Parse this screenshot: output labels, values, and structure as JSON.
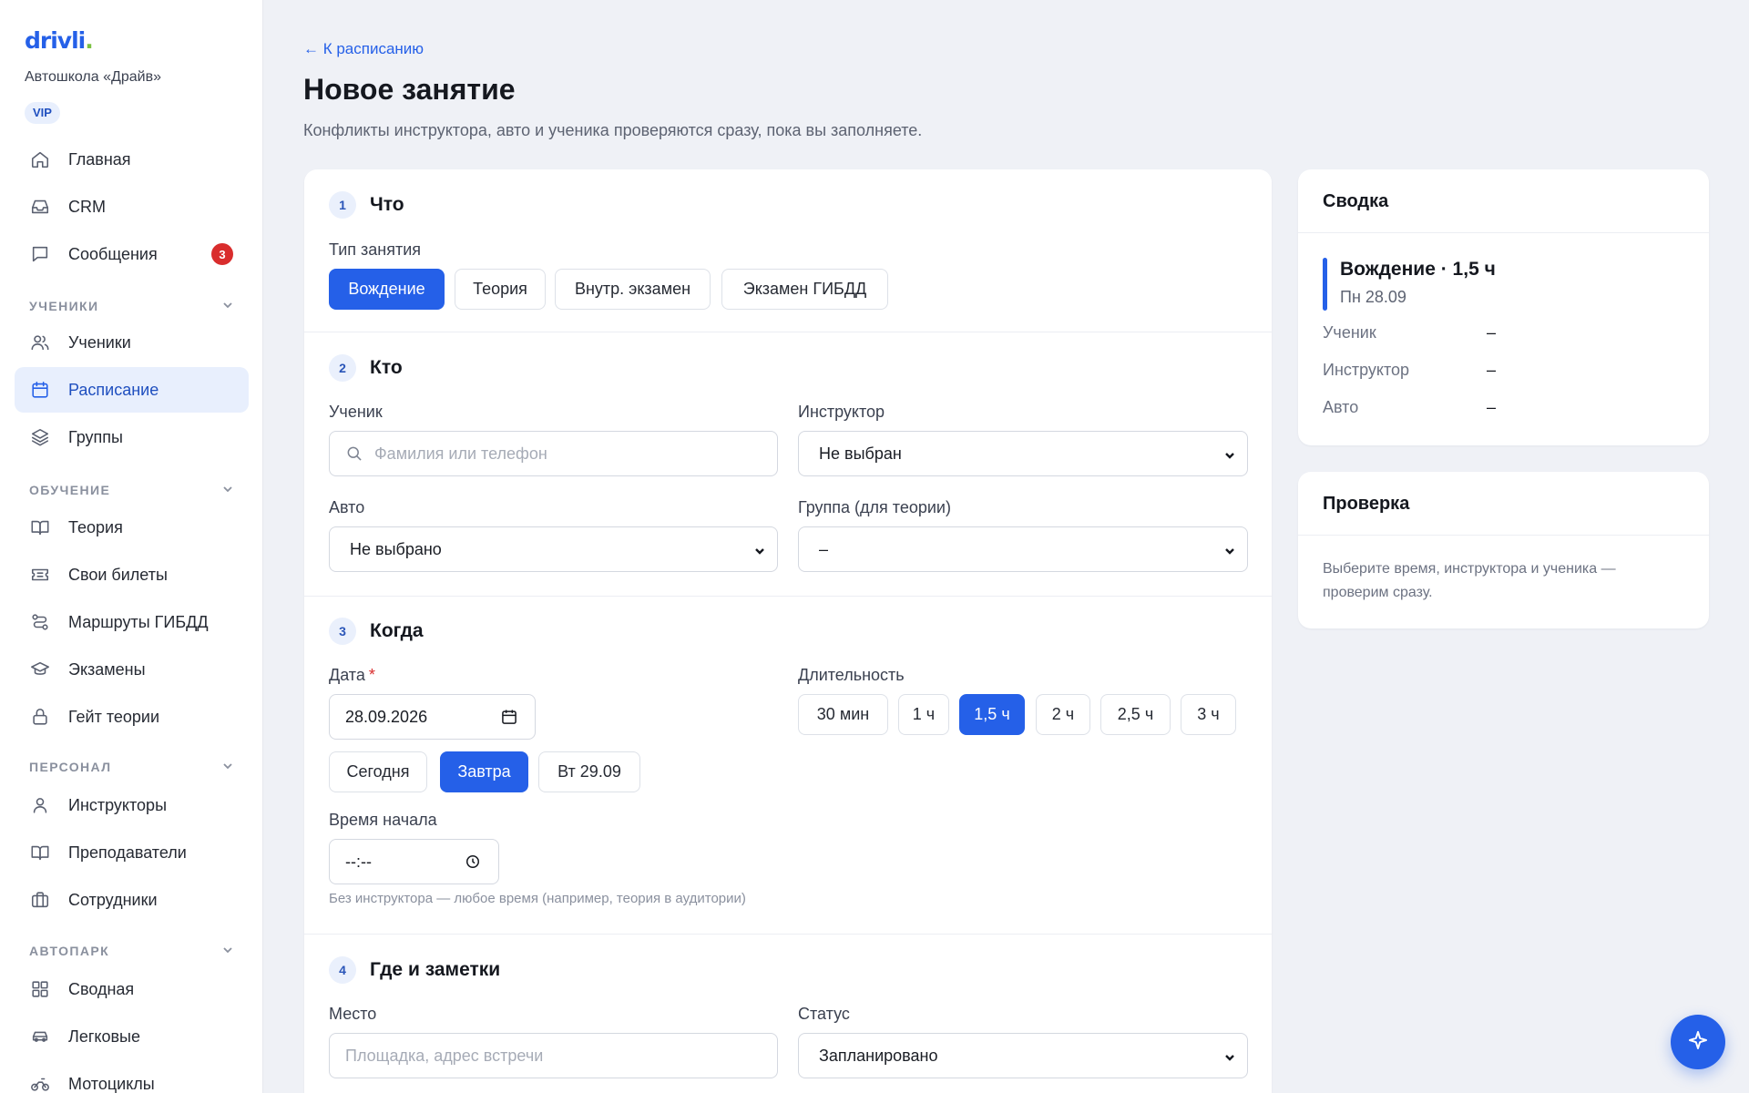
{
  "brand": {
    "logo_text": "drivli",
    "logo_dot": ".",
    "org_name": "Автошкола «Драйв»",
    "plan_badge": "VIP",
    "accent_color": "#2560e8",
    "logo_dot_color": "#7bc142"
  },
  "sidebar": {
    "items": [
      {
        "label": "Главная",
        "icon": "home-icon"
      },
      {
        "label": "CRM",
        "icon": "inbox-icon"
      },
      {
        "label": "Сообщения",
        "icon": "chat-icon",
        "badge": "3"
      },
      {
        "label": "Ученики",
        "icon": "users-icon"
      },
      {
        "label": "Расписание",
        "icon": "calendar-icon",
        "active": true
      },
      {
        "label": "Группы",
        "icon": "layers-icon"
      },
      {
        "label": "Теория",
        "icon": "book-icon"
      },
      {
        "label": "Свои билеты",
        "icon": "ticket-icon"
      },
      {
        "label": "Маршруты ГИБДД",
        "icon": "route-icon"
      },
      {
        "label": "Экзамены",
        "icon": "graduation-cap-icon"
      },
      {
        "label": "Гейт теории",
        "icon": "lock-icon"
      },
      {
        "label": "Инструкторы",
        "icon": "user-icon"
      },
      {
        "label": "Преподаватели",
        "icon": "open-book-icon"
      },
      {
        "label": "Сотрудники",
        "icon": "briefcase-icon"
      },
      {
        "label": "Сводная",
        "icon": "grid-icon"
      },
      {
        "label": "Легковые",
        "icon": "car-icon"
      },
      {
        "label": "Мотоциклы",
        "icon": "motorcycle-icon"
      }
    ],
    "sections": [
      {
        "label": "УЧЕНИКИ"
      },
      {
        "label": "ОБУЧЕНИЕ"
      },
      {
        "label": "ПЕРСОНАЛ"
      },
      {
        "label": "АВТОПАРК"
      }
    ]
  },
  "header": {
    "back_link": "← К расписанию",
    "title": "Новое занятие",
    "subtitle": "Конфликты инструктора, авто и ученика проверяются сразу, пока вы заполняете."
  },
  "form": {
    "step1": {
      "number": "1",
      "title": "Что",
      "type_label": "Тип занятия",
      "types": [
        {
          "label": "Вождение",
          "selected": true
        },
        {
          "label": "Теория"
        },
        {
          "label": "Внутр. экзамен"
        },
        {
          "label": "Экзамен ГИБДД"
        }
      ]
    },
    "step2": {
      "number": "2",
      "title": "Кто",
      "student_label": "Ученик",
      "student_placeholder": "Фамилия или телефон",
      "instructor_label": "Инструктор",
      "instructor_value": "Не выбран",
      "car_label": "Авто",
      "car_value": "Не выбрано",
      "group_label": "Группа (для теории)",
      "group_value": "–"
    },
    "step3": {
      "number": "3",
      "title": "Когда",
      "date_label": "Дата",
      "date_required": "*",
      "date_value": "28.09.2026",
      "date_shortcuts": [
        {
          "label": "Сегодня"
        },
        {
          "label": "Завтра",
          "selected": true
        },
        {
          "label": "Вт 29.09"
        }
      ],
      "duration_label": "Длительность",
      "durations": [
        {
          "label": "30 мин"
        },
        {
          "label": "1 ч"
        },
        {
          "label": "1,5 ч",
          "selected": true
        },
        {
          "label": "2 ч"
        },
        {
          "label": "2,5 ч"
        },
        {
          "label": "3 ч"
        }
      ],
      "start_time_label": "Время начала",
      "start_time_value": "--:--",
      "hint": "Без инструктора — любое время (например, теория в аудитории)"
    },
    "step4": {
      "number": "4",
      "title": "Где и заметки",
      "place_label": "Место",
      "place_placeholder": "Площадка, адрес встречи",
      "status_label": "Статус",
      "status_value": "Запланировано"
    }
  },
  "summary": {
    "title": "Сводка",
    "main": "Вождение · 1,5 ч",
    "date": "Пн 28.09",
    "rows": [
      {
        "label": "Ученик",
        "value": "–"
      },
      {
        "label": "Инструктор",
        "value": "–"
      },
      {
        "label": "Авто",
        "value": "–"
      }
    ]
  },
  "check": {
    "title": "Проверка",
    "text": "Выберите время, инструктора и ученика — проверим сразу."
  },
  "fab": {
    "icon": "sparkle-icon"
  }
}
